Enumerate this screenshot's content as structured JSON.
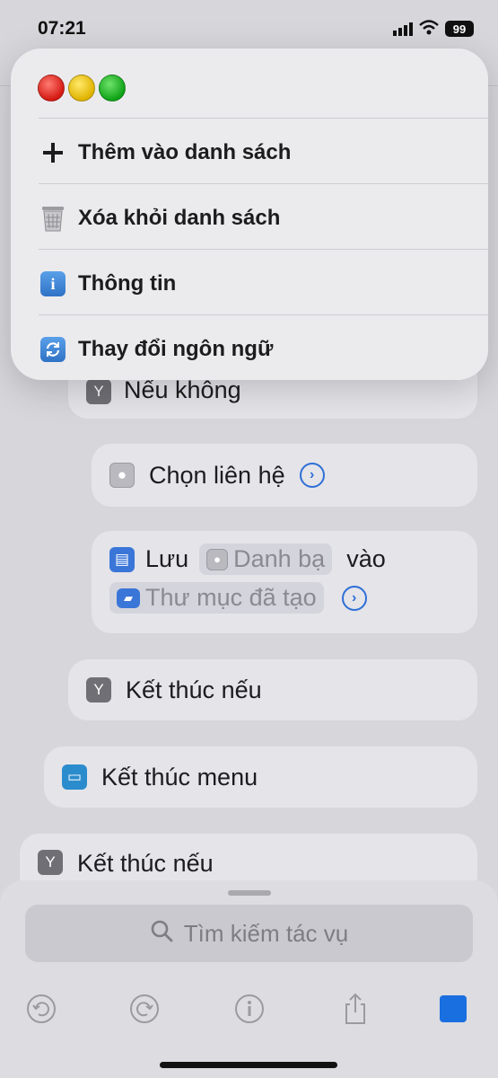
{
  "status_bar": {
    "time": "07:21",
    "battery": "99"
  },
  "popup_menu": {
    "items": [
      {
        "label": "Thêm vào danh sách",
        "icon": "plus-icon"
      },
      {
        "label": "Xóa khỏi danh sách",
        "icon": "trash-icon"
      },
      {
        "label": "Thông tin",
        "icon": "info-icon"
      },
      {
        "label": "Thay đổi ngôn ngữ",
        "icon": "refresh-icon"
      }
    ]
  },
  "editor": {
    "blocks": [
      {
        "label": "Nếu không"
      },
      {
        "label": "Chọn liên hệ"
      },
      {
        "save_label": "Lưu",
        "chip1": "Danh bạ",
        "to_label": "vào",
        "chip2": "Thư mục đã tạo"
      },
      {
        "label": "Kết thúc nếu"
      },
      {
        "label": "Kết thúc menu"
      },
      {
        "label": "Kết thúc nếu"
      }
    ]
  },
  "search": {
    "placeholder": "Tìm kiếm tác vụ"
  },
  "toolbar": {
    "icons": [
      "undo-icon",
      "redo-icon",
      "info-icon",
      "share-icon",
      "stop-button"
    ]
  },
  "colors": {
    "accent": "#1a6fe0",
    "stop": "#1a6fe0"
  }
}
